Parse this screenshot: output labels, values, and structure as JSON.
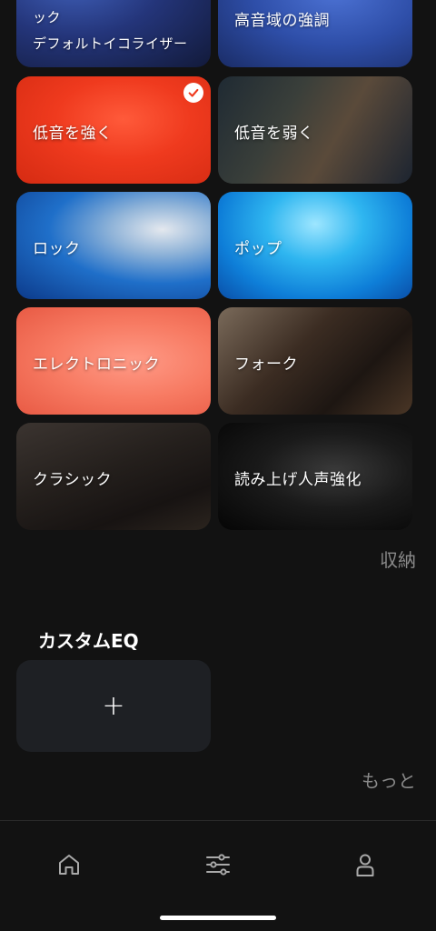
{
  "presets": {
    "top_left": {
      "label_line1": "ック",
      "label_line2": "デフォルトイコライザー"
    },
    "top_right": {
      "label": "高音域の強調"
    },
    "bass_up": {
      "label": "低音を強く",
      "selected": true
    },
    "bass_down": {
      "label": "低音を弱く"
    },
    "rock": {
      "label": "ロック"
    },
    "pop": {
      "label": "ポップ"
    },
    "electronic": {
      "label": "エレクトロニック"
    },
    "folk": {
      "label": "フォーク"
    },
    "classic": {
      "label": "クラシック"
    },
    "vocal": {
      "label": "読み上げ人声強化"
    }
  },
  "collapse_label": "収納",
  "custom_eq": {
    "title": "カスタムEQ",
    "add_symbol": "+"
  },
  "more_label": "もっと",
  "bottom_nav": {
    "items": [
      {
        "name": "home",
        "icon": "home-icon"
      },
      {
        "name": "equalizer",
        "icon": "sliders-icon"
      },
      {
        "name": "profile",
        "icon": "person-icon"
      }
    ]
  },
  "colors": {
    "background": "#121212",
    "card_empty": "#1e2024",
    "muted_text": "#8a8a8a",
    "selected_card": "#ef3a1e"
  }
}
